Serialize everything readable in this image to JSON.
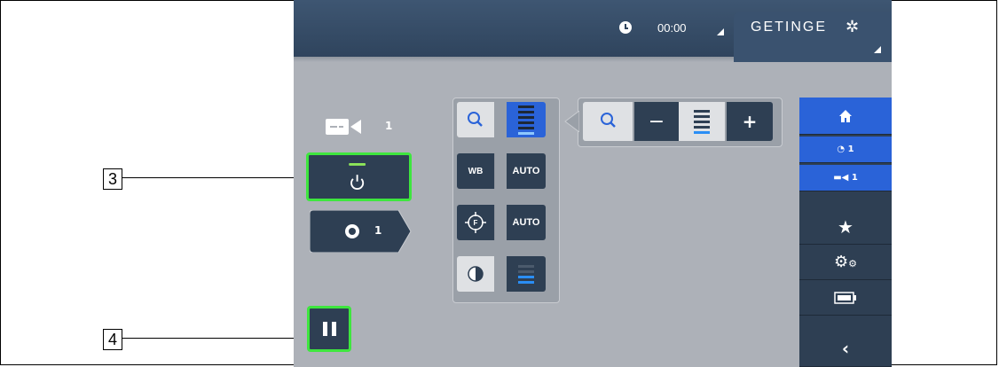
{
  "header": {
    "timer": "00:00",
    "brand": "GETINGE"
  },
  "camera": {
    "number": "1"
  },
  "light": {
    "number": "1"
  },
  "image_settings": {
    "wb_label": "WB",
    "wb_value": "AUTO",
    "focus_value": "AUTO"
  },
  "zoom": {
    "minus_label": "−",
    "plus_label": "+"
  },
  "sidebar": {
    "light_label": "1",
    "camera_label": "1"
  },
  "callouts": {
    "power": "3",
    "pause": "4"
  },
  "colors": {
    "highlight": "#3ee63e",
    "accent_blue": "#2a63d8",
    "button": "#2e3f53"
  }
}
